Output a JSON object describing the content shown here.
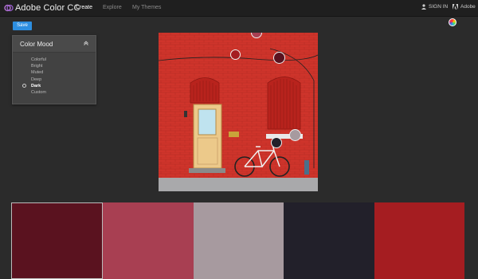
{
  "app": {
    "title": "Adobe Color CC"
  },
  "nav": [
    {
      "label": "Create",
      "active": true
    },
    {
      "label": "Explore",
      "active": false
    },
    {
      "label": "My Themes",
      "active": false
    }
  ],
  "account": {
    "signin_label": "SIGN IN",
    "adobe_label": "Adobe"
  },
  "toolbar": {
    "save_label": "Save"
  },
  "color_mood": {
    "title": "Color Mood",
    "options": [
      "Colorful",
      "Bright",
      "Muted",
      "Deep",
      "Dark",
      "Custom"
    ],
    "selected": "Dark"
  },
  "theme": {
    "colors": [
      "#5a121f",
      "#a83f52",
      "#a79a9f",
      "#22202a",
      "#a51d21"
    ],
    "selected_index": 0
  },
  "icons": {
    "logo": "adobe-color-logo-icon",
    "user": "user-icon",
    "adobe": "adobe-logo-icon",
    "wheel": "color-wheel-icon",
    "collapse": "chevron-up-icon"
  }
}
